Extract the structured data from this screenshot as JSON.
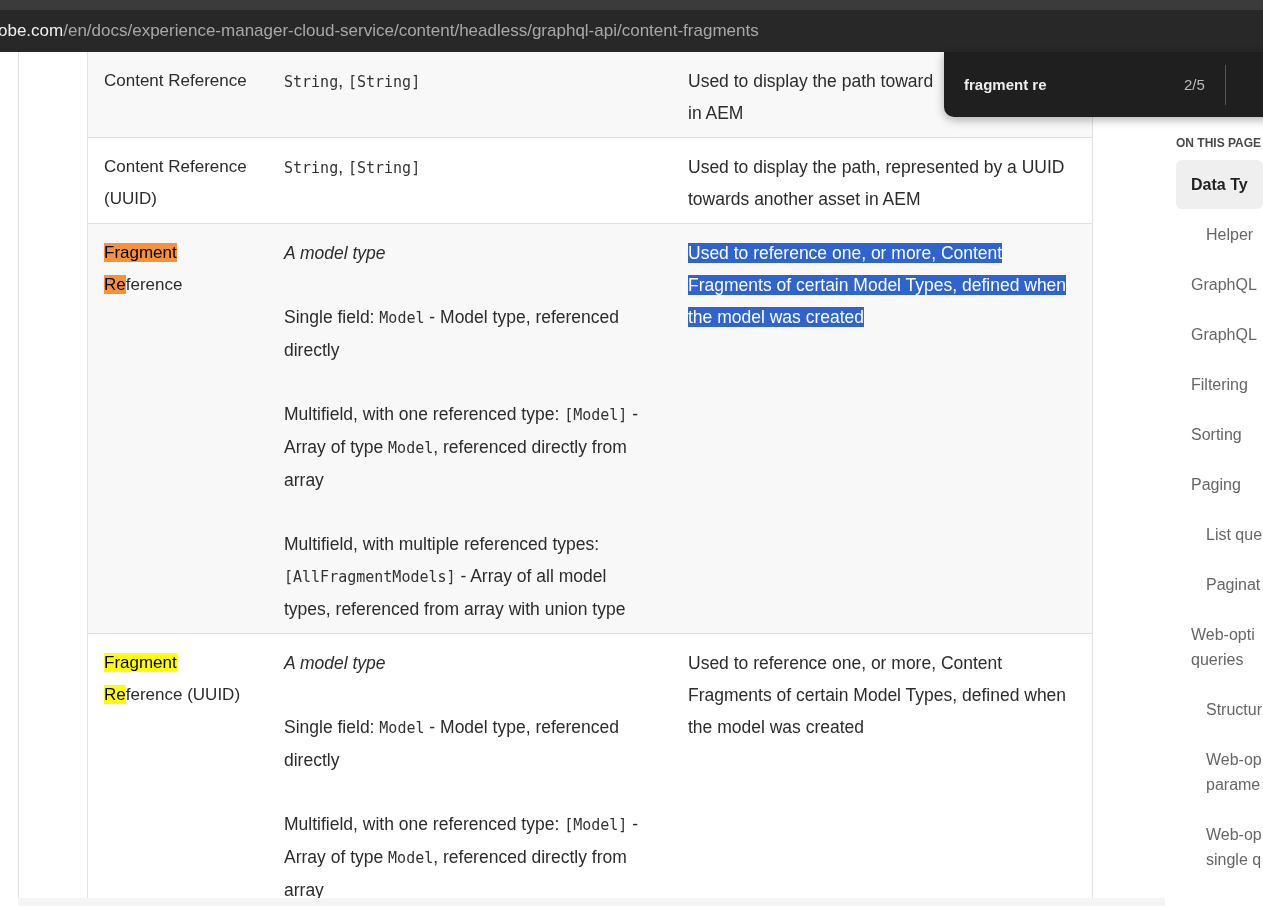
{
  "address_bar": {
    "host": "obe.com",
    "path": "/en/docs/experience-manager-cloud-service/content/headless/graphql-api/content-fragments"
  },
  "find_bar": {
    "value": "fragment re",
    "count": "2/5"
  },
  "table": {
    "rows": [
      {
        "name": [
          {
            "text": "Content Reference",
            "highlighted": false
          }
        ],
        "type": [
          [
            {
              "text": "String",
              "kind": "code"
            },
            {
              "text": ", ",
              "kind": "text"
            },
            {
              "text": "[String]",
              "kind": "code"
            }
          ]
        ],
        "description": {
          "lines": [
            "Used to display the path toward",
            "in AEM"
          ],
          "selected": false
        }
      },
      {
        "name": [
          {
            "text": "Content Reference (UUID)",
            "highlighted": false
          }
        ],
        "type": [
          [
            {
              "text": "String",
              "kind": "code"
            },
            {
              "text": ", ",
              "kind": "text"
            },
            {
              "text": "[String]",
              "kind": "code"
            }
          ]
        ],
        "description": {
          "lines": [
            "Used to display the path, represented by a UUID towards another asset in AEM"
          ],
          "selected": false
        }
      },
      {
        "name": [
          {
            "text": "Fragment Re",
            "highlighted": true,
            "current": true
          },
          {
            "text": "ference",
            "highlighted": false
          }
        ],
        "type": [
          [
            {
              "text": "A model type",
              "kind": "italic"
            }
          ],
          [
            {
              "text": "Single field: ",
              "kind": "text"
            },
            {
              "text": "Model",
              "kind": "code"
            },
            {
              "text": " - Model type, referenced directly",
              "kind": "text"
            }
          ],
          [
            {
              "text": "Multifield, with one referenced type: ",
              "kind": "text"
            },
            {
              "text": "[Model]",
              "kind": "code"
            },
            {
              "text": " - Array of type ",
              "kind": "text"
            },
            {
              "text": "Model",
              "kind": "code"
            },
            {
              "text": ", referenced directly from array",
              "kind": "text"
            }
          ],
          [
            {
              "text": "Multifield, with multiple referenced types: ",
              "kind": "text"
            },
            {
              "text": "[AllFragmentModels]",
              "kind": "code"
            },
            {
              "text": " - Array of all model types, referenced from array with union type",
              "kind": "text"
            }
          ]
        ],
        "description": {
          "lines": [
            "Used to reference one, or more, Content Fragments of certain Model Types, defined when the model was created"
          ],
          "selected": true
        }
      },
      {
        "name": [
          {
            "text": "Fragment Re",
            "highlighted": true,
            "current": false
          },
          {
            "text": "ference (UUID)",
            "highlighted": false
          }
        ],
        "type": [
          [
            {
              "text": "A model type",
              "kind": "italic"
            }
          ],
          [
            {
              "text": "Single field: ",
              "kind": "text"
            },
            {
              "text": "Model",
              "kind": "code"
            },
            {
              "text": " - Model type, referenced directly",
              "kind": "text"
            }
          ],
          [
            {
              "text": "Multifield, with one referenced type: ",
              "kind": "text"
            },
            {
              "text": "[Model]",
              "kind": "code"
            },
            {
              "text": " - Array of type ",
              "kind": "text"
            },
            {
              "text": "Model",
              "kind": "code"
            },
            {
              "text": ", referenced directly from array",
              "kind": "text"
            }
          ]
        ],
        "description": {
          "lines": [
            "Used to reference one, or more, Content Fragments of certain Model Types, defined when the model was created"
          ],
          "selected": false
        }
      }
    ]
  },
  "toc": {
    "heading": "ON THIS PAGE",
    "items": [
      {
        "text": "Data Ty",
        "selected": true,
        "children": [
          {
            "text": "Helper",
            "selected": false
          }
        ]
      },
      {
        "text": "GraphQL",
        "selected": false
      },
      {
        "text": "GraphQL",
        "selected": false
      },
      {
        "text": "Filtering",
        "selected": false
      },
      {
        "text": "Sorting",
        "selected": false
      },
      {
        "text": "Paging",
        "selected": false,
        "children": [
          {
            "text": "List que",
            "selected": false
          },
          {
            "text": "Paginat",
            "selected": false
          }
        ]
      },
      {
        "text": "Web-opti\nqueries",
        "selected": false,
        "children": [
          {
            "text": "Structur",
            "selected": false
          },
          {
            "text": "Web-op\nparame",
            "selected": false
          },
          {
            "text": "Web-op\nsingle q",
            "selected": false
          }
        ]
      }
    ]
  }
}
